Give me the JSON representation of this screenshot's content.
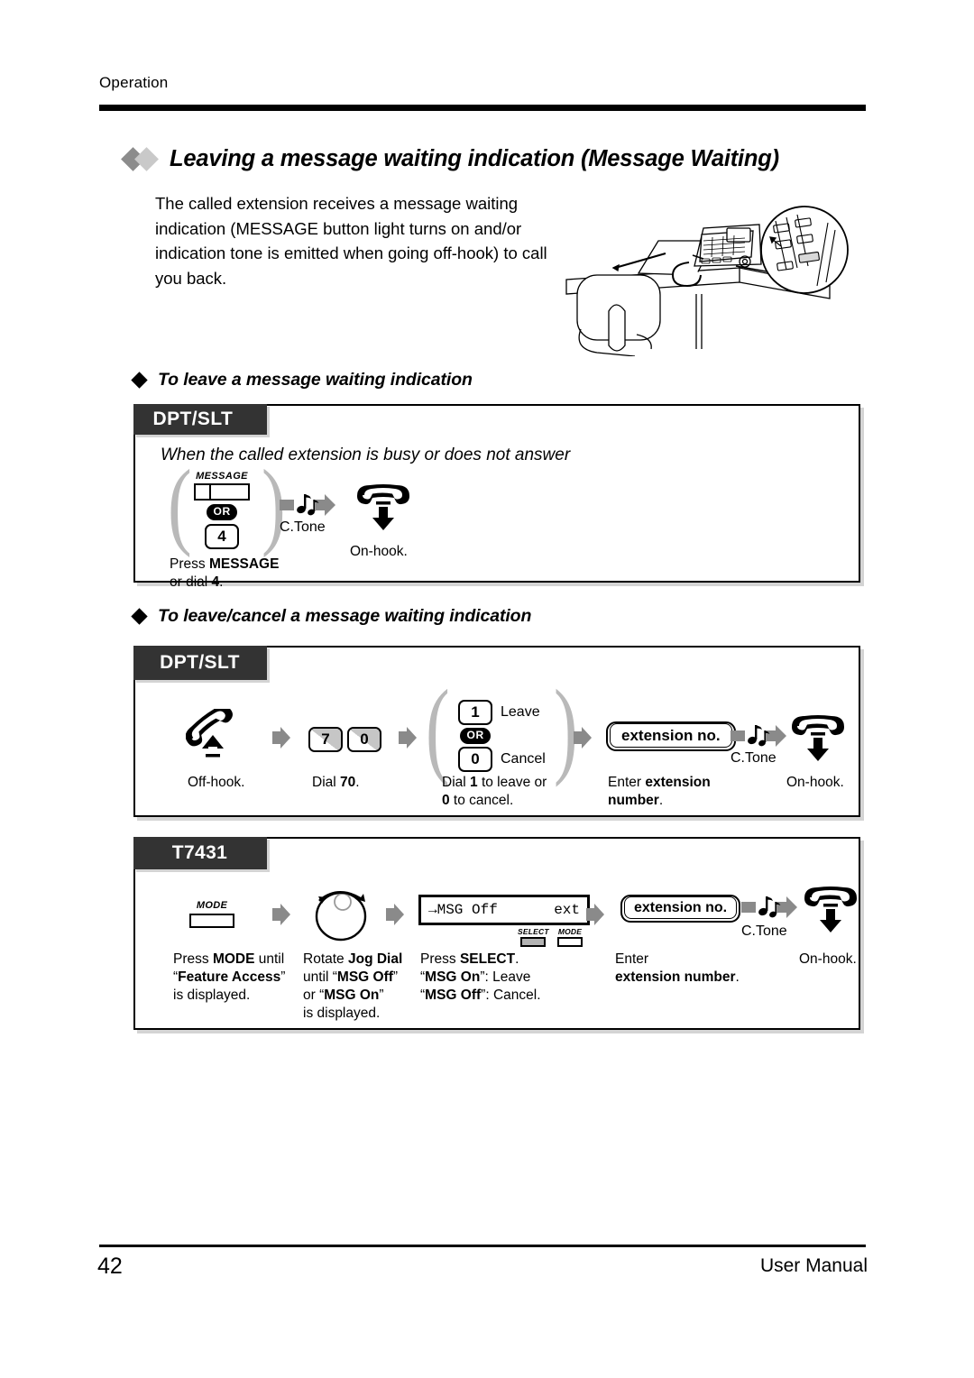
{
  "header": {
    "section_label": "Operation"
  },
  "heading": {
    "text": "Leaving a message waiting indication (Message Waiting)"
  },
  "intro": {
    "text": "The called extension receives a message waiting indication (MESSAGE button light turns on and/or indication tone is emitted when going off-hook) to call you back."
  },
  "illustration": {
    "name": "desk-phone-illustration"
  },
  "section1": {
    "sub_heading": "To leave a message waiting indication",
    "tab_label": "DPT/SLT",
    "caption": "When the called extension is busy or does not answer",
    "steps": [
      {
        "icon": "message-button",
        "button_label": "MESSAGE",
        "or_label": "OR",
        "key": "4",
        "note_line1_pre": "Press ",
        "note_line1_bold": "MESSAGE",
        "note_line2_pre": "or dial ",
        "note_line2_bold": "4",
        "note_line2_post": "."
      },
      {
        "icon": "c-tone-icon",
        "label": "C.Tone"
      },
      {
        "icon": "on-hook-icon",
        "note": "On-hook."
      }
    ]
  },
  "section2": {
    "sub_heading": "To leave/cancel a message waiting indication",
    "tab_label": "DPT/SLT",
    "steps": [
      {
        "icon": "off-hook-icon",
        "note": "Off-hook."
      },
      {
        "icon": "dial-keys",
        "keys": [
          "7",
          "0"
        ],
        "note_pre": "Dial ",
        "note_bold": "70",
        "note_post": "."
      },
      {
        "icon": "option-group",
        "option1_key": "1",
        "option1_label": "Leave",
        "or_label": "OR",
        "option2_key": "0",
        "option2_label": "Cancel",
        "note_l1_a": "Dial ",
        "note_l1_b": "1",
        "note_l1_c": " to leave or",
        "note_l2_a": "0",
        "note_l2_b": " to cancel."
      },
      {
        "icon": "extension-no-button",
        "button_label": "extension no.",
        "note_l1_a": "Enter ",
        "note_l1_b": "extension",
        "note_l2_a": "number",
        "note_l2_b": "."
      },
      {
        "icon": "c-tone-icon",
        "label": "C.Tone"
      },
      {
        "icon": "on-hook-icon",
        "note": "On-hook."
      }
    ]
  },
  "section3": {
    "tab_label": "T7431",
    "steps": [
      {
        "icon": "mode-key",
        "key_label": "MODE",
        "note_l1_a": "Press ",
        "note_l1_b": "MODE",
        "note_l1_c": " until",
        "note_l2_a": "“",
        "note_l2_b": "Feature Access",
        "note_l2_c": "”",
        "note_l3": "is displayed."
      },
      {
        "icon": "jog-dial",
        "note_l1_a": "Rotate ",
        "note_l1_b": "Jog Dial",
        "note_l2_a": "until “",
        "note_l2_b": "MSG Off",
        "note_l2_c": "”",
        "note_l3_a": "or “",
        "note_l3_b": "MSG On",
        "note_l3_c": "”",
        "note_l4": "is displayed."
      },
      {
        "icon": "lcd-display",
        "lcd_left": "→MSG Off",
        "lcd_right": "ext",
        "softkey_select_label": "SELECT",
        "softkey_mode_label": "MODE",
        "note_l1_a": "Press ",
        "note_l1_b": "SELECT",
        "note_l1_c": ".",
        "note_l2_a": "“",
        "note_l2_b": "MSG On",
        "note_l2_c": "”: Leave",
        "note_l3_a": "“",
        "note_l3_b": "MSG Off",
        "note_l3_c": "”: Cancel."
      },
      {
        "icon": "extension-no-button",
        "button_label": "extension no.",
        "note_l1": "Enter",
        "note_l2_a": "extension number",
        "note_l2_b": "."
      },
      {
        "icon": "c-tone-icon",
        "label": "C.Tone"
      },
      {
        "icon": "on-hook-icon",
        "note": "On-hook."
      }
    ]
  },
  "footer": {
    "page_number": "42",
    "title": "User Manual"
  }
}
